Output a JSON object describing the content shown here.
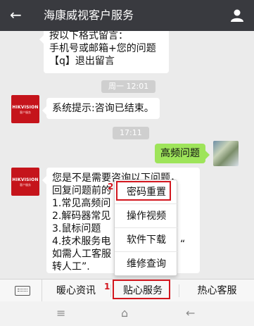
{
  "header": {
    "back_icon": "←",
    "title": "海康威视客户服务"
  },
  "chat": {
    "msg_top_lines": [
      "按以下格式留言：",
      "手机号或邮箱+您的问题",
      "【q】退出留言"
    ],
    "time1": "周一 12:01",
    "system_msg": "系统提示:咨询已结束。",
    "time2": "17:11",
    "user_msg": "高频问题",
    "bot_reply_lines": [
      "您是不是需要咨询以下问题，",
      "回复问题前的",
      "1.常见高频问",
      "2.解码器常见",
      "3.鼠标问题",
      "4.技术服务电",
      "如需人工客服",
      "转人工”."
    ],
    "bot_reply_tail": "“",
    "hik_logo_text": "HIKVISION",
    "hik_logo_sub": "客户服务"
  },
  "popup": {
    "items": [
      "密码重置",
      "操作视频",
      "软件下载",
      "维修查询"
    ],
    "step_marker": "2"
  },
  "bottom_menu": {
    "tabs": [
      "暖心资讯",
      "贴心服务",
      "热心客服"
    ],
    "step_marker": "1"
  },
  "nav": {
    "menu_icon": "≡",
    "home_icon": "⌂",
    "back_icon": "←"
  },
  "colors": {
    "header_bg": "#393a3f",
    "user_bubble": "#9ee45a",
    "highlight_red": "#d2161e",
    "brand_red": "#c5141b"
  }
}
